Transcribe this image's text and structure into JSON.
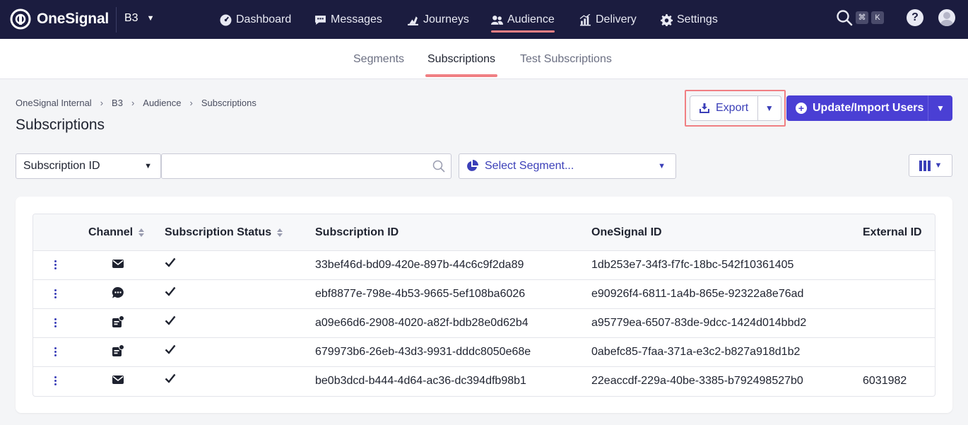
{
  "brand": {
    "name": "OneSignal",
    "app": "B3"
  },
  "nav": {
    "items": [
      {
        "label": "Dashboard",
        "icon": "dashboard-icon"
      },
      {
        "label": "Messages",
        "icon": "messages-icon"
      },
      {
        "label": "Journeys",
        "icon": "journeys-icon"
      },
      {
        "label": "Audience",
        "icon": "audience-icon",
        "active": true
      },
      {
        "label": "Delivery",
        "icon": "delivery-icon"
      },
      {
        "label": "Settings",
        "icon": "gear-icon"
      }
    ],
    "shortcut": {
      "mod": "⌘",
      "key": "K"
    },
    "help": "?"
  },
  "subtabs": [
    {
      "label": "Segments"
    },
    {
      "label": "Subscriptions",
      "active": true
    },
    {
      "label": "Test Subscriptions"
    }
  ],
  "breadcrumb": [
    "OneSignal Internal",
    "B3",
    "Audience",
    "Subscriptions"
  ],
  "page_title": "Subscriptions",
  "actions": {
    "export_label": "Export",
    "import_label": "Update/Import Users"
  },
  "filters": {
    "field_value": "Subscription ID",
    "search_value": "",
    "segment_placeholder": "Select Segment..."
  },
  "table": {
    "headers": {
      "channel": "Channel",
      "status": "Subscription Status",
      "subscription_id": "Subscription ID",
      "onesignal_id": "OneSignal ID",
      "external_id": "External ID"
    },
    "rows": [
      {
        "channel": "email",
        "status": "subscribed",
        "subscription_id": "33bef46d-bd09-420e-897b-44c6c9f2da89",
        "onesignal_id": "1db253e7-34f3-f7fc-18bc-542f10361405",
        "external_id": ""
      },
      {
        "channel": "sms",
        "status": "subscribed",
        "subscription_id": "ebf8877e-798e-4b53-9665-5ef108ba6026",
        "onesignal_id": "e90926f4-6811-1a4b-865e-92322a8e76ad",
        "external_id": ""
      },
      {
        "channel": "push",
        "status": "subscribed",
        "subscription_id": "a09e66d6-2908-4020-a82f-bdb28e0d62b4",
        "onesignal_id": "a95779ea-6507-83de-9dcc-1424d014bbd2",
        "external_id": ""
      },
      {
        "channel": "push",
        "status": "subscribed",
        "subscription_id": "679973b6-26eb-43d3-9931-dddc8050e68e",
        "onesignal_id": "0abefc85-7faa-371a-e3c2-b827a918d1b2",
        "external_id": ""
      },
      {
        "channel": "email",
        "status": "subscribed",
        "subscription_id": "be0b3dcd-b444-4d64-ac36-dc394dfb98b1",
        "onesignal_id": "22eaccdf-229a-40be-3385-b792498527b0",
        "external_id": "6031982"
      }
    ]
  },
  "colors": {
    "nav_bg": "#1b1c3f",
    "accent": "#4a3fd4",
    "highlight": "#f07f83",
    "link": "#3b3fb8"
  }
}
